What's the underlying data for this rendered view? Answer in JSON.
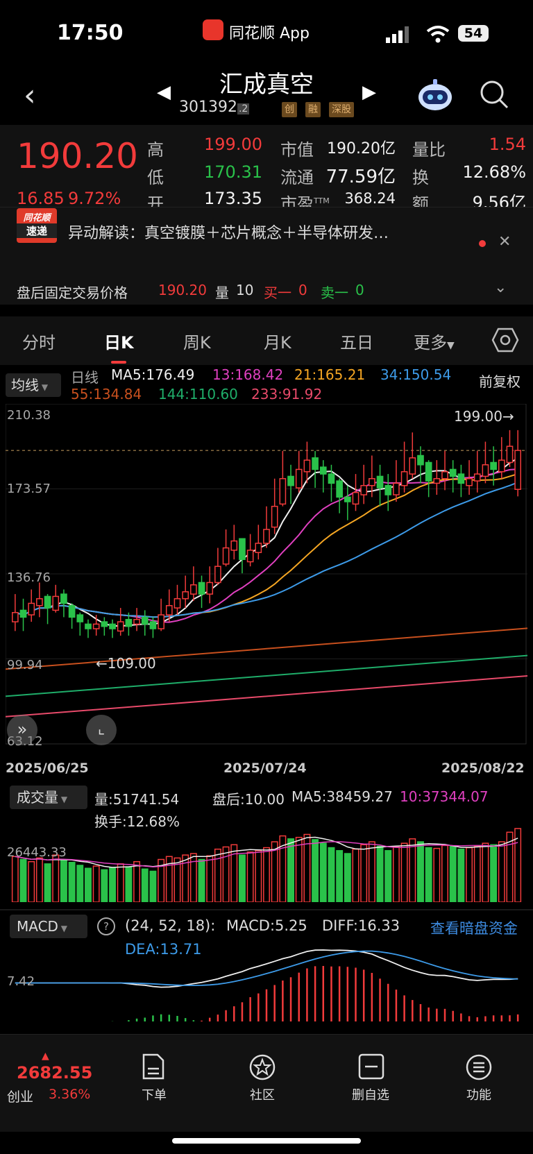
{
  "status_bar": {
    "time": "17:50",
    "app_name": "同花顺 App",
    "battery": "54"
  },
  "header": {
    "title": "汇成真空",
    "code": "301392",
    "code_suffix": ".2",
    "tags": [
      "创",
      "融",
      "深股"
    ]
  },
  "quote": {
    "price": "190.20",
    "change": "16.85",
    "change_pct": "9.72%",
    "fields": [
      {
        "label": "高",
        "value": "199.00",
        "color": "red"
      },
      {
        "label": "低",
        "value": "170.31",
        "color": "green"
      },
      {
        "label": "开",
        "value": "173.35",
        "color": "white"
      },
      {
        "label": "市值",
        "value": "190.20亿",
        "color": "white"
      },
      {
        "label": "流通",
        "value": "77.59亿",
        "color": "white"
      },
      {
        "label": "市盈",
        "sup": "TTM",
        "value": "368.24",
        "color": "white"
      },
      {
        "label": "量比",
        "value": "1.54",
        "color": "red"
      },
      {
        "label": "换",
        "value": "12.68%",
        "color": "white"
      },
      {
        "label": "额",
        "value": "9.56亿",
        "color": "white"
      }
    ]
  },
  "news": {
    "badge_line1": "同花顺",
    "badge_line2": "速递",
    "text": "异动解读：真空镀膜＋芯片概念＋半导体研发…",
    "after_hours_label": "盘后固定交易价格",
    "after_hours_price": "190.20",
    "volume_label": "量",
    "volume_value": "10",
    "buy_label": "买一",
    "buy_value": "0",
    "sell_label": "卖一",
    "sell_value": "0"
  },
  "tabs": [
    "分时",
    "日K",
    "周K",
    "月K",
    "五日",
    "更多"
  ],
  "selected_tab": "日K",
  "ma_legend": {
    "button": "均线",
    "line_type": "日线",
    "items": [
      {
        "text": "MA5:176.49",
        "color": "#f0f0f0"
      },
      {
        "text": "13:168.42",
        "color": "#e040c0"
      },
      {
        "text": "21:165.21",
        "color": "#f5a623"
      },
      {
        "text": "34:150.54",
        "color": "#3d9be9"
      },
      {
        "text": "55:134.84",
        "color": "#c8501e"
      },
      {
        "text": "144:110.60",
        "color": "#1fae6a"
      },
      {
        "text": "233:91.92",
        "color": "#e84a6a"
      }
    ],
    "adjust": "前复权"
  },
  "chart_data": [
    {
      "type": "candlestick",
      "y_ticks": [
        "210.38",
        "173.57",
        "136.76",
        "99.94",
        "63.12"
      ],
      "ylim": [
        63.12,
        210.38
      ],
      "x_labels": [
        "2025/06/25",
        "2025/07/24",
        "2025/08/22"
      ],
      "high_annotation": "199.00",
      "low_annotation": "109.00",
      "close": [
        120,
        118,
        124,
        126,
        122,
        127,
        124,
        118,
        116,
        113,
        115,
        114,
        113,
        116,
        114,
        117,
        115,
        113,
        119,
        123,
        126,
        129,
        132,
        128,
        133,
        140,
        148,
        151,
        143,
        147,
        150,
        156,
        166,
        178,
        175,
        182,
        186,
        182,
        180,
        176,
        170,
        168,
        172,
        175,
        178,
        174,
        171,
        176,
        181,
        187,
        184,
        177,
        178,
        181,
        179,
        176,
        178,
        180,
        184,
        182,
        186,
        192,
        190.2
      ],
      "high": [
        128,
        126,
        130,
        133,
        128,
        132,
        130,
        124,
        120,
        117,
        119,
        118,
        117,
        122,
        120,
        122,
        121,
        118,
        126,
        130,
        132,
        136,
        140,
        136,
        140,
        148,
        156,
        158,
        152,
        154,
        158,
        166,
        178,
        190,
        184,
        190,
        194,
        190,
        186,
        184,
        178,
        175,
        180,
        184,
        188,
        184,
        180,
        186,
        194,
        198,
        192,
        186,
        186,
        190,
        186,
        184,
        186,
        190,
        194,
        192,
        196,
        199,
        199
      ],
      "low": [
        112,
        112,
        116,
        118,
        115,
        120,
        118,
        113,
        110,
        109,
        110,
        110,
        109,
        110,
        110,
        112,
        110,
        109,
        112,
        116,
        119,
        122,
        125,
        122,
        124,
        132,
        140,
        143,
        137,
        140,
        143,
        148,
        154,
        166,
        167,
        172,
        176,
        174,
        172,
        168,
        163,
        160,
        164,
        167,
        170,
        166,
        164,
        168,
        172,
        178,
        176,
        170,
        171,
        173,
        172,
        170,
        171,
        172,
        176,
        175,
        178,
        183,
        170.31
      ],
      "open": [
        116,
        121,
        119,
        123,
        127,
        121,
        128,
        123,
        119,
        115,
        113,
        116,
        115,
        112,
        117,
        115,
        118,
        116,
        113,
        119,
        122,
        126,
        128,
        133,
        128,
        133,
        141,
        147,
        152,
        142,
        146,
        150,
        157,
        167,
        179,
        174,
        181,
        187,
        183,
        180,
        177,
        170,
        167,
        171,
        175,
        179,
        175,
        171,
        175,
        180,
        188,
        185,
        176,
        178,
        182,
        180,
        175,
        177,
        179,
        185,
        181,
        185,
        173.35
      ]
    },
    {
      "type": "bar",
      "title": "成交量",
      "legend": [
        "量:51741.54",
        "盘后:10.00",
        "MA5:38459.27",
        "10:37344.07"
      ],
      "turnover": "换手:12.68%",
      "y_tick": "26443.33",
      "values": [
        62,
        58,
        55,
        60,
        52,
        64,
        57,
        54,
        50,
        46,
        49,
        44,
        47,
        52,
        48,
        55,
        45,
        42,
        58,
        62,
        60,
        64,
        66,
        58,
        63,
        72,
        75,
        78,
        64,
        68,
        70,
        74,
        82,
        90,
        86,
        88,
        92,
        85,
        80,
        74,
        70,
        66,
        72,
        78,
        82,
        76,
        70,
        75,
        80,
        86,
        82,
        74,
        73,
        77,
        76,
        72,
        74,
        76,
        80,
        78,
        82,
        95,
        100
      ]
    },
    {
      "type": "bar",
      "title": "MACD",
      "params": "(24, 52, 18):",
      "macd": "MACD:5.25",
      "diff": "DIFF:16.33",
      "dea": "DEA:13.71",
      "link": "查看暗盘资金",
      "y_tick": "7.42"
    }
  ],
  "bottom_nav": {
    "index_value": "2682.55",
    "index_name": "创业",
    "index_pct": "3.36%",
    "items": [
      "下单",
      "社区",
      "删自选",
      "功能"
    ]
  },
  "colors": {
    "up": "#f23b3b",
    "down": "#2ac24a",
    "bg": "#000000"
  }
}
